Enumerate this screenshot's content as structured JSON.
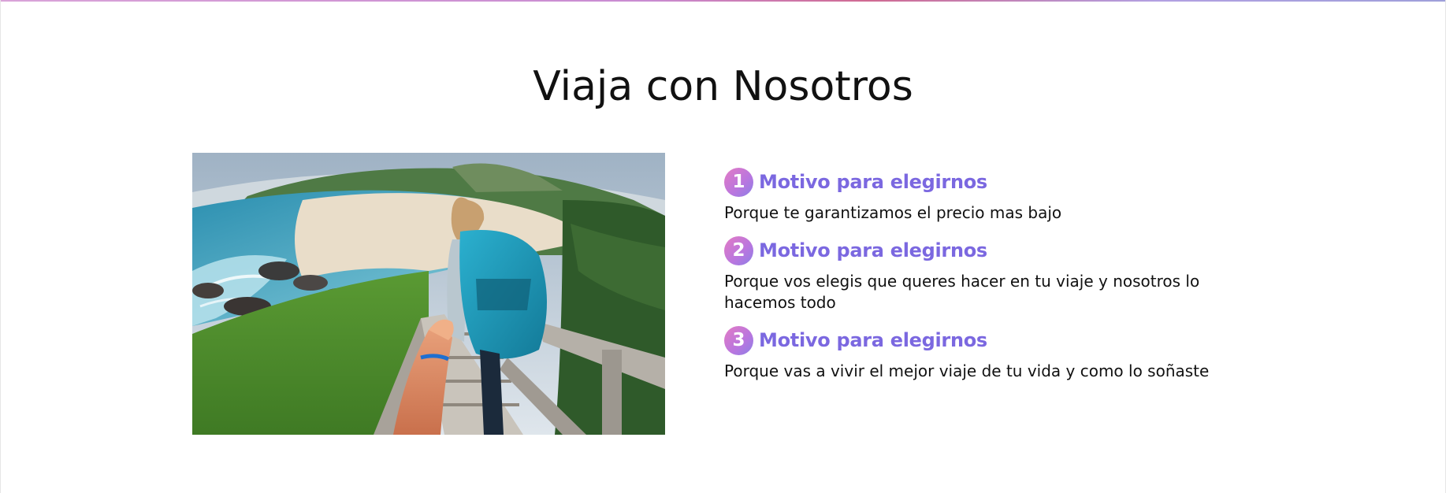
{
  "section": {
    "title": "Viaja con Nosotros",
    "image_alt": "Viajera con mochila bajando escaleras hacia una playa"
  },
  "reasons": [
    {
      "number": "1",
      "title": "Motivo para elegirnos",
      "text": "Porque te garantizamos el precio mas bajo"
    },
    {
      "number": "2",
      "title": "Motivo para elegirnos",
      "text": "Porque vos elegis que queres hacer en tu viaje y nosotros lo hacemos todo"
    },
    {
      "number": "3",
      "title": "Motivo para elegirnos",
      "text": "Porque vas a vivir el mejor viaje de tu vida y como lo soñaste"
    }
  ],
  "colors": {
    "accent": "#7b68e0",
    "badge_gradient_start": "#e47bc4",
    "badge_gradient_end": "#8c7fe6",
    "text": "#111111"
  }
}
